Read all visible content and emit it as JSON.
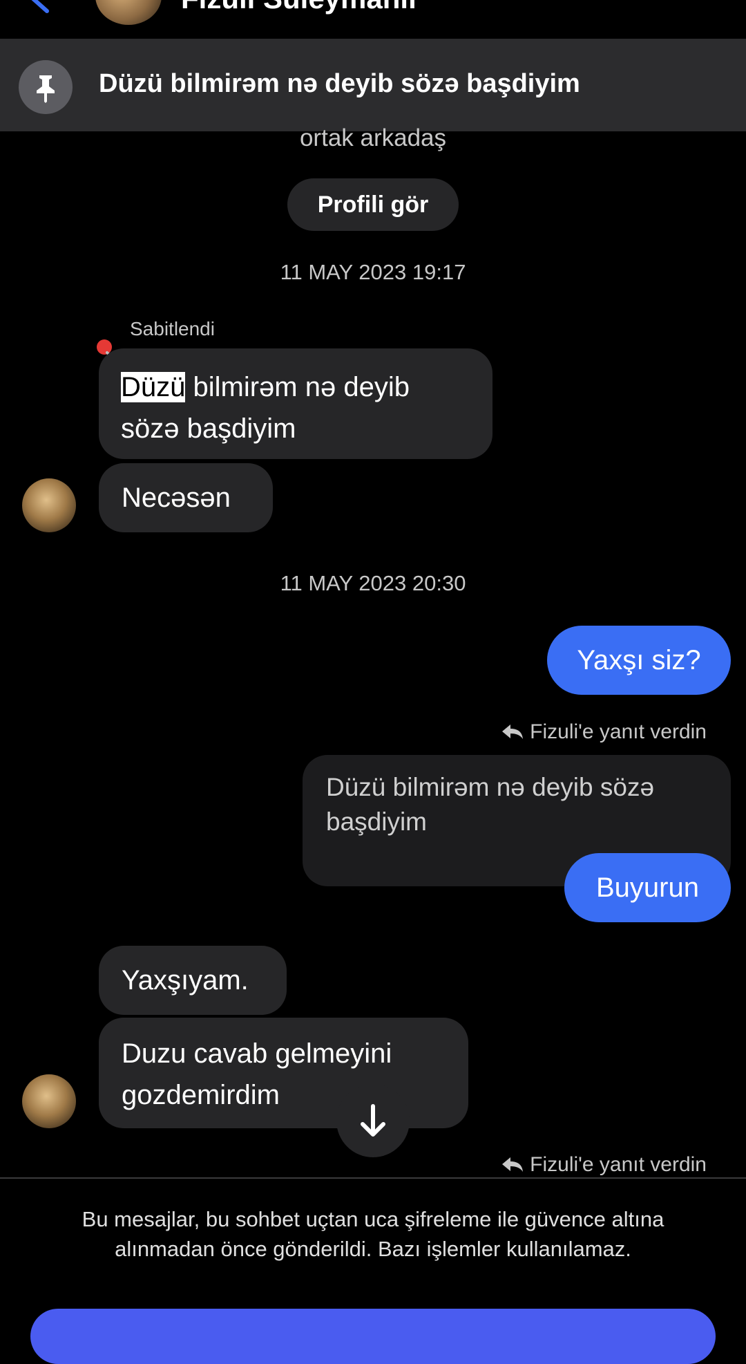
{
  "header": {
    "name": "Fizuli Süleymanlı"
  },
  "pinned_bar": {
    "text": "Düzü bilmirəm nə deyib sözə başdiyim"
  },
  "intro": {
    "mutual_text": "ortak arkadaş",
    "profile_button": "Profili gör"
  },
  "timestamps": [
    "11 MAY 2023 19:17",
    "11 MAY 2023 20:30"
  ],
  "pinned_message": {
    "label": "Sabitlendi",
    "highlight": "Düzü",
    "rest": " bilmirəm nə deyib sözə başdiyim"
  },
  "messages": {
    "incoming_1": "Necəsən",
    "outgoing_1": "Yaxşı siz?",
    "reply_info_1": "Fizuli'e yanıt verdin",
    "quoted_text": "Düzü bilmirəm nə deyib sözə başdiyim",
    "outgoing_2": "Buyurun",
    "incoming_2": "Yaxşıyam.",
    "incoming_3": "Duzu cavab gelmeyini gozdemirdim",
    "reply_info_2": "Fizuli'e yanıt verdin"
  },
  "notice": {
    "text": "Bu mesajlar, bu sohbet uçtan uca şifreleme ile güvence altına alınmadan önce gönderildi. Bazı işlemler kullanılamaz."
  },
  "colors": {
    "background": "#000000",
    "incoming_bubble": "#262628",
    "outgoing_bubble": "#3a6ef4",
    "pinned_bar": "#2c2c2e",
    "bottom_button": "#4a5cf0"
  }
}
